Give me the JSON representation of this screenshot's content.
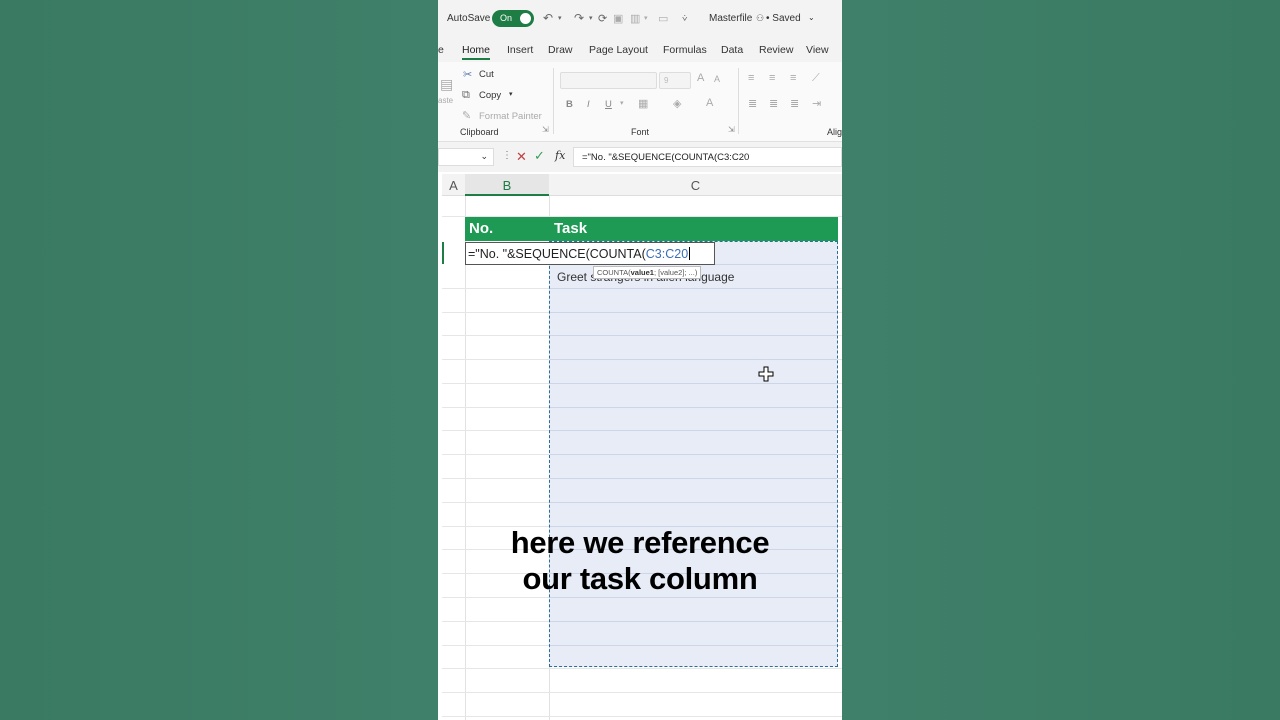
{
  "titlebar": {
    "autosave_label": "AutoSave",
    "toggle_label": "On",
    "filename": "Masterfile",
    "status": "• Saved"
  },
  "tabs": [
    {
      "label": "e"
    },
    {
      "label": "Home"
    },
    {
      "label": "Insert"
    },
    {
      "label": "Draw"
    },
    {
      "label": "Page Layout"
    },
    {
      "label": "Formulas"
    },
    {
      "label": "Data"
    },
    {
      "label": "Review"
    },
    {
      "label": "View"
    }
  ],
  "ribbon": {
    "clipboard": {
      "cut": "Cut",
      "copy": "Copy",
      "format_painter": "Format Painter",
      "paste_fragment": "aste",
      "group_label": "Clipboard"
    },
    "font": {
      "size": "9",
      "bold": "B",
      "italic": "I",
      "underline": "U",
      "group_label": "Font"
    },
    "alignment": {
      "group_label": "Alig"
    }
  },
  "formula_bar": {
    "fx": "fx",
    "formula": "=\"No. \"&SEQUENCE(COUNTA(C3:C20"
  },
  "grid": {
    "columns": [
      "A",
      "B",
      "C"
    ],
    "header_no": "No.",
    "header_task": "Task",
    "edit_prefix": "=\"No. \"&SEQUENCE(COUNTA(",
    "edit_ref": "C3:C20",
    "task_row3": "Greet strangers in alien language",
    "tooltip_fn": "COUNTA(",
    "tooltip_arg1": "value1",
    "tooltip_rest": "; [value2]; ...)"
  },
  "caption": {
    "line1": "here we reference",
    "line2": "our task column"
  },
  "colors": {
    "accent": "#1e7c45",
    "table_header": "#1f9a55",
    "selection_fill": "#e8ecf7",
    "reference": "#3a6fb5"
  }
}
